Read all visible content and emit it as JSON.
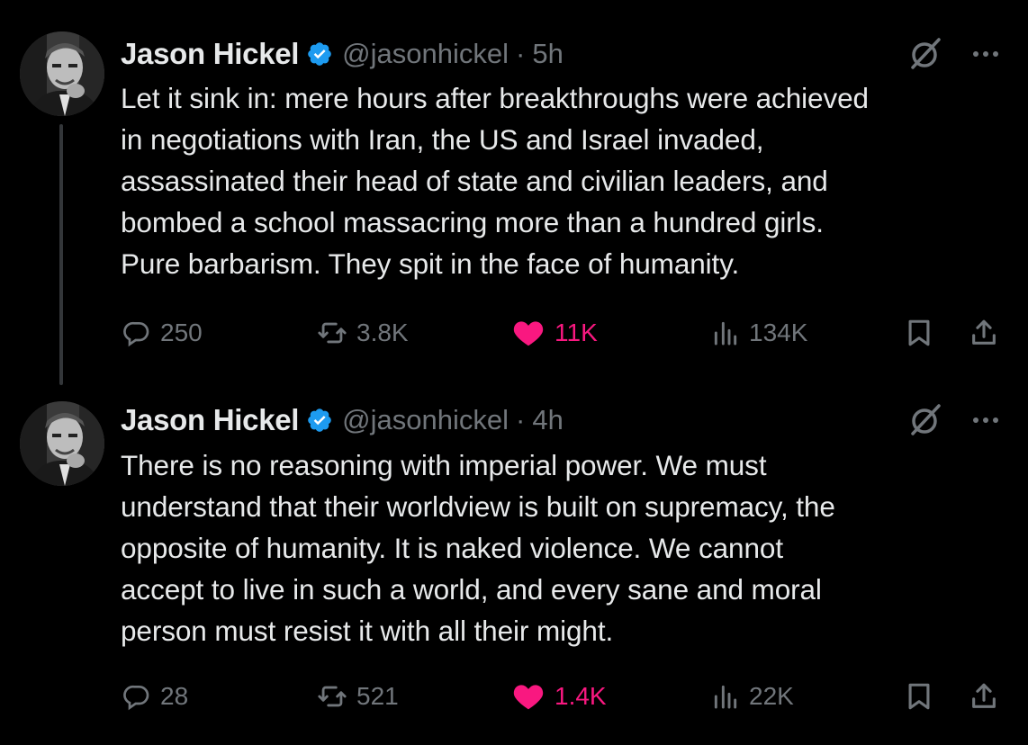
{
  "colors": {
    "background": "#000000",
    "text": "#e7e9ea",
    "muted": "#71767b",
    "like": "#f91880",
    "verified": "#1d9bf0",
    "thread_line": "#333639"
  },
  "tweets": [
    {
      "display_name": "Jason Hickel",
      "handle": "@jasonhickel",
      "separator": "·",
      "time": "5h",
      "text": "Let it sink in: mere hours after breakthroughs were achieved\nin negotiations with Iran, the US and Israel invaded,\nassassinated their head of state and civilian leaders, and\nbombed a school massacring more than a hundred girls.\nPure barbarism. They spit in the face of humanity.",
      "replies": "250",
      "reposts": "3.8K",
      "likes": "11K",
      "views": "134K"
    },
    {
      "display_name": "Jason Hickel",
      "handle": "@jasonhickel",
      "separator": "·",
      "time": "4h",
      "text": "There is no reasoning with imperial power.  We must\nunderstand that their worldview is built on supremacy, the\nopposite of humanity.  It is naked violence.  We cannot\naccept to live in such a world, and every sane and moral\nperson must resist it with all their might.",
      "replies": "28",
      "reposts": "521",
      "likes": "1.4K",
      "views": "22K"
    }
  ],
  "icons": {
    "avatar": "avatar",
    "verified": "verified-badge-icon",
    "grok": "grok-icon",
    "more": "more-icon",
    "reply": "reply-icon",
    "repost": "repost-icon",
    "like": "heart-icon",
    "views": "views-icon",
    "bookmark": "bookmark-icon",
    "share": "share-icon"
  }
}
